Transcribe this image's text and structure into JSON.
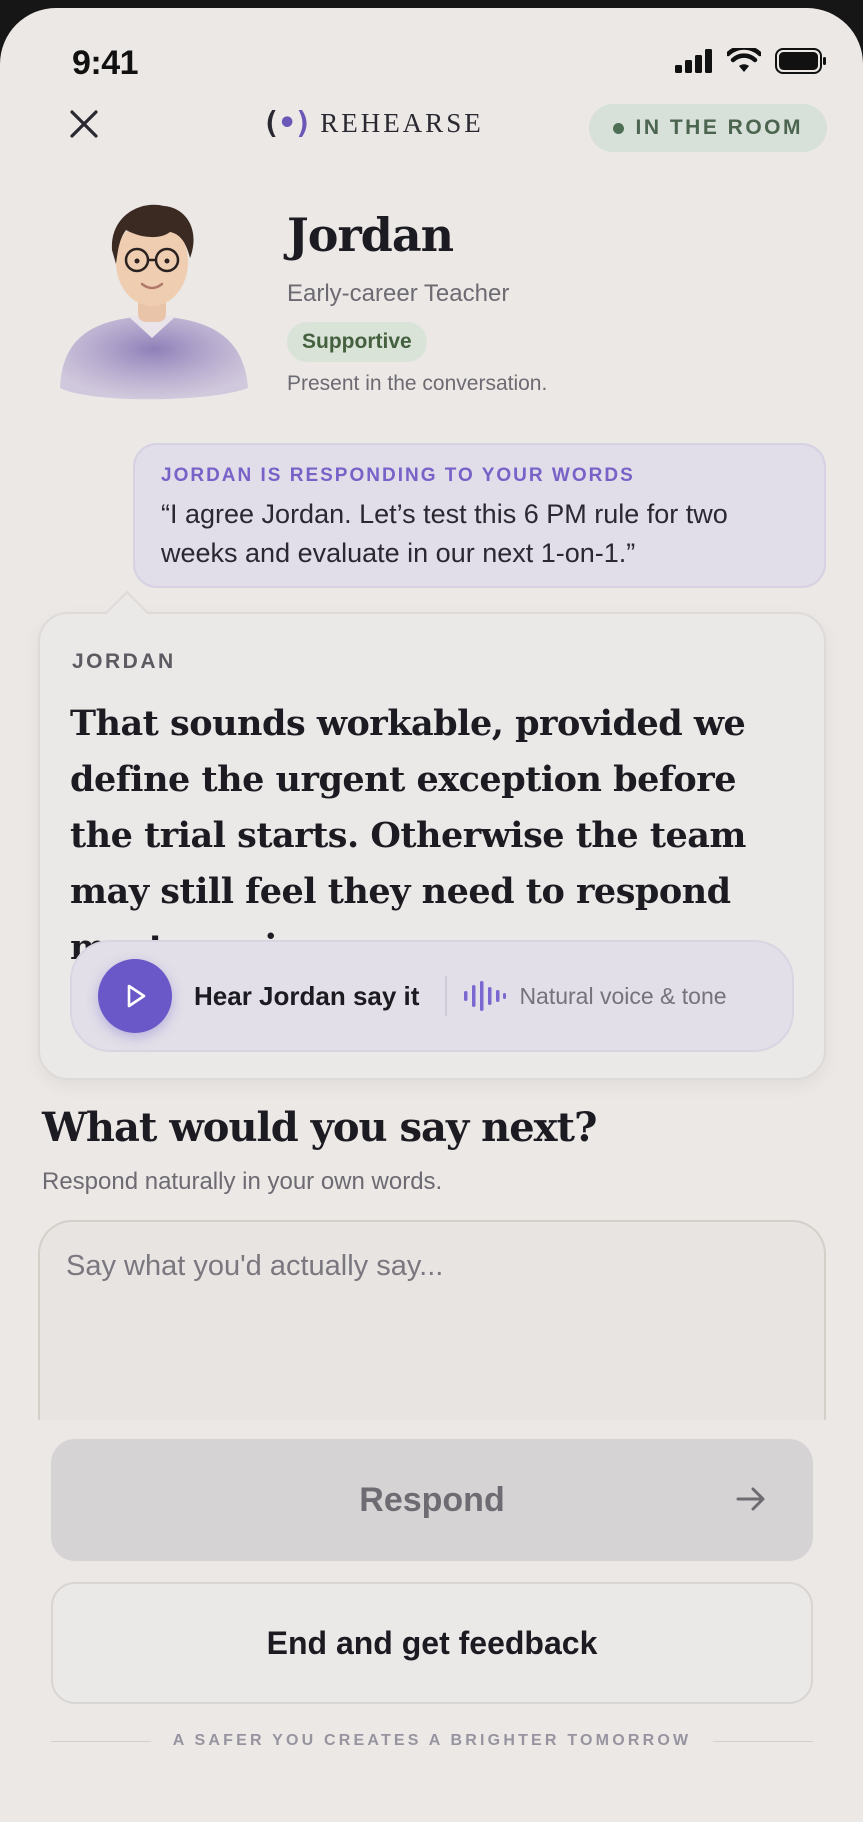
{
  "status_bar": {
    "time": "9:41"
  },
  "header": {
    "close_icon": "close-icon",
    "brand_mark_left": "(",
    "brand_mark_dot": "•",
    "brand_mark_right": ")",
    "brand_name": "REHEARSE",
    "room_status": "IN THE ROOM",
    "room_status_color": "#4e6f56"
  },
  "persona": {
    "name": "Jordan",
    "role": "Early-career Teacher",
    "tone": "Supportive",
    "presence": "Present in the conversation."
  },
  "user_quote": {
    "label": "JORDAN IS RESPONDING TO YOUR WORDS",
    "text": "“I agree Jordan. Let’s test this 6 PM rule for two weeks and evaluate in our next 1-on-1.”"
  },
  "response": {
    "speaker": "JORDAN",
    "text": "That sounds workable, provided we define the urgent exception before the trial starts. Otherwise the team may still feel they need to respond most evenings.",
    "audio_label": "Hear Jordan say it",
    "audio_sub": "Natural voice & tone"
  },
  "prompt": {
    "title": "What would you say next?",
    "subtitle": "Respond naturally in your own words.",
    "input_placeholder": "Say what you'd actually say...",
    "input_value": ""
  },
  "actions": {
    "respond_label": "Respond",
    "feedback_label": "End and get feedback"
  },
  "footer": {
    "tagline": "A SAFER YOU CREATES A BRIGHTER TOMORROW"
  },
  "colors": {
    "accent": "#6a58c8",
    "background": "#ebe8e6",
    "quote_bg": "#e1dde9",
    "badge_bg": "#d9e3d8"
  }
}
